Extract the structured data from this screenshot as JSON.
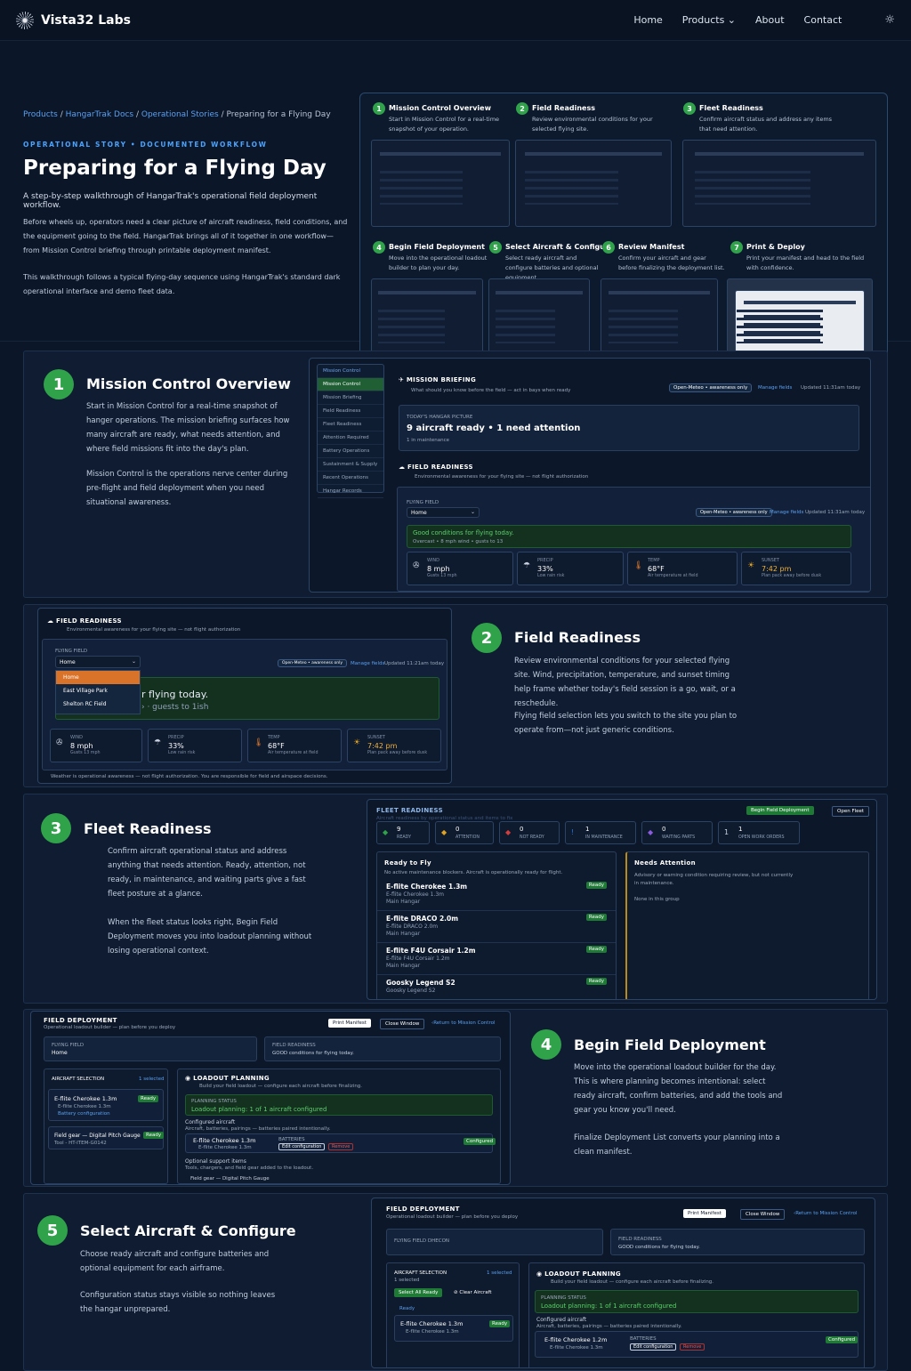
{
  "nav": {
    "brand": "Vista32 Labs",
    "home": "Home",
    "products": "Products",
    "about": "About",
    "contact": "Contact"
  },
  "hero": {
    "crumb": [
      "Products",
      "HangarTrak Docs",
      "Operational Stories",
      "Preparing for a Flying Day"
    ],
    "eyebrow": "OPERATIONAL STORY  •  DOCUMENTED WORKFLOW",
    "title": "Preparing for a Flying Day",
    "lede": "A step-by-step walkthrough of HangarTrak's operational field deployment workflow.",
    "p1": "Before wheels up, operators need a clear picture of aircraft readiness, field conditions, and the equipment going to the field. HangarTrak brings all of it together in one workflow— from Mission Control briefing through printable deployment manifest.",
    "p2": "This walkthrough follows a typical flying-day sequence using HangarTrak's standard dark operational interface and demo fleet data."
  },
  "steps": [
    {
      "n": "1",
      "t": "Mission Control Overview",
      "d": "Start in Mission Control for a real-time snapshot of your operation."
    },
    {
      "n": "2",
      "t": "Field Readiness",
      "d": "Review environmental conditions for your selected flying site."
    },
    {
      "n": "3",
      "t": "Fleet Readiness",
      "d": "Confirm aircraft status and address any items that need attention."
    },
    {
      "n": "4",
      "t": "Begin Field Deployment",
      "d": "Move into the operational loadout builder to plan your day."
    },
    {
      "n": "5",
      "t": "Select Aircraft & Configure",
      "d": "Select ready aircraft and configure batteries and optional equipment."
    },
    {
      "n": "6",
      "t": "Review Manifest",
      "d": "Confirm your aircraft and gear before finalizing the deployment list."
    },
    {
      "n": "7",
      "t": "Print & Deploy",
      "d": "Print your manifest and head to the field with confidence."
    }
  ],
  "s1": {
    "n": "1",
    "title": "Mission Control Overview",
    "p1": "Start in Mission Control for a real-time snapshot of hanger operations. The mission briefing surfaces how many aircraft are ready, what needs attention, and where field missions fit into the day's plan.",
    "p2": "Mission Control is the operations nerve center during pre-flight and field deployment when you need situational awareness.",
    "side": [
      "Mission Control",
      "Mission Control",
      "Mission Briefing",
      "Field Readiness",
      "Fleet Readiness",
      "Attention Required",
      "Battery Operations",
      "Sustainment & Supply",
      "Recent Operations",
      "Hangar Records"
    ],
    "brief": "MISSION BRIEFING",
    "brief_sub": "What should you know before the field — act in bays when ready",
    "badge": "Open-Meteo • awareness only",
    "manage": "Manage fields",
    "updated": "Updated 11:31am today",
    "picture": "TODAY'S HANGAR PICTURE",
    "ready": "9 aircraft ready • 1 need attention",
    "maint": "1 in maintenance",
    "fr": "FIELD READINESS",
    "fr_sub": "Environmental awareness for your flying site — not flight authorization",
    "ff": "FLYING FIELD",
    "field": "Home",
    "updated2": "Updated 11:31am today",
    "good": "Good conditions for flying today.",
    "good_sub": "Overcast • 8 mph wind • gusts to 13"
  },
  "weather": [
    {
      "icon": "✇",
      "k": "WIND",
      "v": "8 mph",
      "s": "Gusts 13 mph"
    },
    {
      "icon": "☂",
      "k": "PRECIP",
      "v": "33%",
      "s": "Low rain risk"
    },
    {
      "icon": "🌡",
      "k": "TEMP",
      "v": "68°F",
      "s": "Air temperature at field"
    },
    {
      "icon": "☀",
      "k": "SUNSET",
      "v": "7:42 pm",
      "s": "Plan pack away before dusk"
    }
  ],
  "s2": {
    "n": "2",
    "title": "Field Readiness",
    "p1": "Review environmental conditions for your selected flying site. Wind, precipitation, temperature, and sunset timing help frame whether today's field session is a go, wait, or a reschedule.",
    "p2": "Flying field selection lets you switch to the site you plan to operate from—not just generic conditions.",
    "fr": "FIELD READINESS",
    "fr_sub": "Environmental awareness for your flying site — not flight authorization",
    "ff": "FLYING FIELD",
    "field": "Home",
    "opts": [
      "Home",
      "East Village Park",
      "Shelton RC Field"
    ],
    "good": "r flying today.",
    "gust": "› · guests to 1ish",
    "badge": "Open-Meteo • awareness only",
    "manage": "Manage fields",
    "updated": "Updated 11:21am today",
    "foot": "Weather is operational awareness — not flight authorization. You are responsible for field and airspace decisions."
  },
  "s3": {
    "n": "3",
    "title": "Fleet Readiness",
    "p1": "Confirm aircraft operational status and address anything that needs attention. Ready, attention, not ready, in maintenance, and waiting parts give a fast fleet posture at a glance.",
    "p2": "When the fleet status looks right, Begin Field Deployment moves you into loadout planning without losing operational context.",
    "head": "FLEET READINESS",
    "head_sub": "Aircraft readiness by operational status and items to fix",
    "b1": "Begin Field Deployment",
    "b2": "Open Fleet",
    "stats": [
      {
        "i": "◆",
        "v": "9",
        "l": "READY",
        "c": "#2fa24a"
      },
      {
        "i": "◆",
        "v": "0",
        "l": "ATTENTION",
        "c": "#e0a321"
      },
      {
        "i": "◆",
        "v": "0",
        "l": "NOT READY",
        "c": "#d23d3d"
      },
      {
        "i": "!",
        "v": "1",
        "l": "IN MAINTENANCE",
        "c": "#2f6fd2"
      },
      {
        "i": "◆",
        "v": "0",
        "l": "WAITING PARTS",
        "c": "#8b5be0"
      },
      {
        "i": "1",
        "v": "1",
        "l": "OPEN WORK ORDERS",
        "c": "#5b6b84"
      }
    ],
    "rtf": "Ready to Fly",
    "rtf_sub": "No active maintenance blockers. Aircraft is operationally ready for flight.",
    "na": "Needs Attention",
    "na_sub": "Advisory or warning condition requiring review, but not currently in maintenance.",
    "none": "None in this group",
    "rows": [
      {
        "a": "E-flite Cherokee 1.3m",
        "b": "E-flite Cherokee 1.3m",
        "c": "Main Hangar"
      },
      {
        "a": "E-flite DRACO 2.0m",
        "b": "E-flite DRACO 2.0m",
        "c": "Main Hangar"
      },
      {
        "a": "E-flite F4U Corsair 1.2m",
        "b": "E-flite F4U Corsair 1.2m",
        "c": "Main Hangar"
      },
      {
        "a": "Goosky Legend S2",
        "b": "Goosky Legend S2",
        "c": ""
      }
    ],
    "ready": "Ready"
  },
  "s4": {
    "n": "4",
    "title": "Begin Field Deployment",
    "p1": "Move into the operational loadout builder for the day. This is where planning becomes intentional: select ready aircraft, confirm batteries, and add the tools and gear you know you'll need.",
    "p2": "Finalize Deployment List converts your planning into a clean manifest.",
    "fd": "FIELD DEPLOYMENT",
    "fd_sub": "Operational loadout builder — plan before you deploy",
    "print": "Print Manifest",
    "close": "Close Window",
    "ret": "‹Return to Mission Control",
    "ff": "FLYING FIELD",
    "field": "Home",
    "frl": "FIELD READINESS",
    "frv": "GOOD conditions for flying today.",
    "sel": "AIRCRAFT SELECTION",
    "selc": "1 selected",
    "a1": "E-flite Cherokee 1.3m",
    "a1s": "E-flite Cherokee 1.3m",
    "a1t": "Battery configuration",
    "g1": "Field gear — Digital Pitch Gauge",
    "g1s": "Tool - HT-ITEM-G0142",
    "ready": "Ready",
    "lp": "LOADOUT PLANNING",
    "lp_sub": "Build your field loadout — configure each aircraft before finalizing.",
    "ps": "PLANNING STATUS",
    "pst": "Loadout planning: 1 of 1 aircraft configured",
    "ca": "Configured aircraft",
    "cas": "Aircraft, batteries, pairings — batteries paired intentionally.",
    "ac": "E-flite Cherokee 1.3m",
    "acs": "E-flite Cherokee 1.3m",
    "bat": "BATTERIES",
    "edit": "Edit configuration",
    "rem": "Remove",
    "conf": "Configured",
    "opt": "Optional support items",
    "opts": "Tools, chargers, and field gear added to the loadout.",
    "fg": "Field gear — Digital Pitch Gauge"
  },
  "s5": {
    "n": "5",
    "title": "Select Aircraft & Configure",
    "p1": "Choose ready aircraft and configure batteries and optional equipment for each airframe.",
    "p2": "Configuration status stays visible so nothing leaves the hangar unprepared.",
    "fd": "FIELD DEPLOYMENT",
    "fd_sub": "Operational loadout builder — plan before you deploy",
    "print": "Print Manifest",
    "close": "Close Window",
    "ret": "‹Return to Mission Control",
    "ff": "FLYING FIELD DHECON",
    "frl": "FIELD READINESS",
    "frv": "GOOD conditions for flying today.",
    "sel": "AIRCRAFT SELECTION",
    "selc": "1 selected",
    "sels": "1 selected",
    "sa": "Select All Ready",
    "ca": "Clear Aircraft",
    "rl": "Ready",
    "a1": "E-flite Cherokee 1.3m",
    "a1s": "E-flite Cherokee 1.3m",
    "ready": "Ready",
    "lp": "LOADOUT PLANNING",
    "lp_sub": "Build your field loadout — configure each aircraft before finalizing.",
    "ps": "PLANNING STATUS",
    "pst": "Loadout planning: 1 of 1 aircraft configured",
    "cfa": "Configured aircraft",
    "cfas": "Aircraft, batteries, pairings — batteries paired intentionally.",
    "ac": "E-flite Cherokee 1.2m",
    "acs": "E-flite Cherokee 1.3m",
    "bat": "BATTERIES",
    "edit": "Edit configuration",
    "rem": "Remove",
    "conf": "Configured"
  }
}
